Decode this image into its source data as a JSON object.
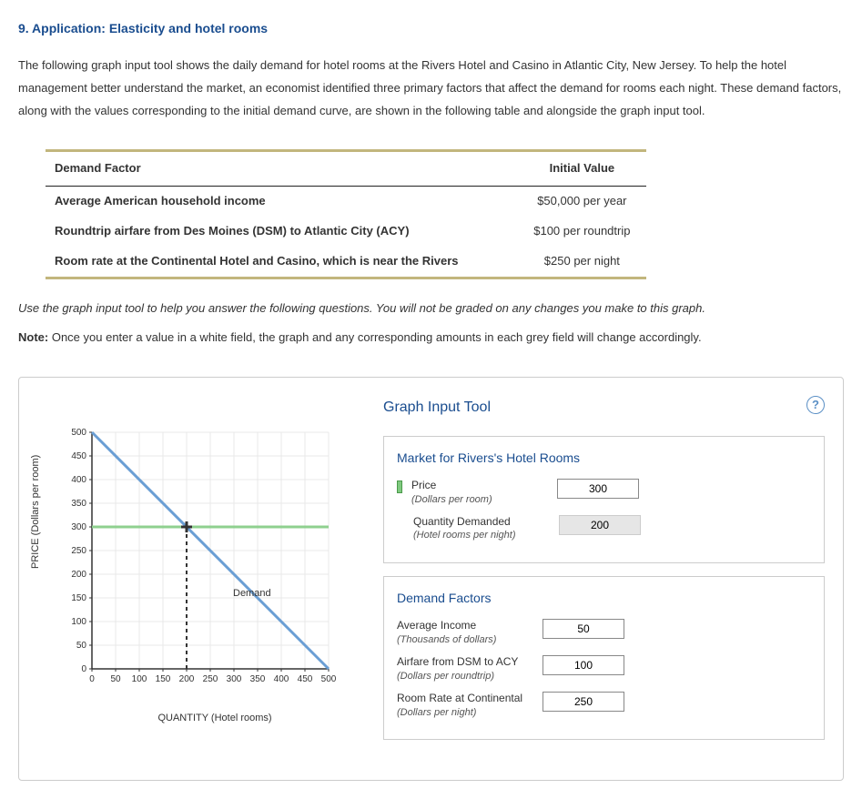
{
  "heading": "9. Application: Elasticity and hotel rooms",
  "intro": "The following graph input tool shows the daily demand for hotel rooms at the Rivers Hotel and Casino in Atlantic City, New Jersey. To help the hotel management better understand the market, an economist identified three primary factors that affect the demand for rooms each night. These demand factors, along with the values corresponding to the initial demand curve, are shown in the following table and alongside the graph input tool.",
  "table": {
    "headers": {
      "factor": "Demand Factor",
      "value": "Initial Value"
    },
    "rows": [
      {
        "factor": "Average American household income",
        "value": "$50,000 per year"
      },
      {
        "factor": "Roundtrip airfare from Des Moines (DSM) to Atlantic City (ACY)",
        "value": "$100 per roundtrip"
      },
      {
        "factor": "Room rate at the Continental Hotel and Casino, which is near the Rivers",
        "value": "$250 per night"
      }
    ]
  },
  "instruction": "Use the graph input tool to help you answer the following questions. You will not be graded on any changes you make to this graph.",
  "note_label": "Note:",
  "note": " Once you enter a value in a white field, the graph and any corresponding amounts in each grey field will change accordingly.",
  "tool": {
    "title": "Graph Input Tool",
    "market_title": "Market for Rivers's Hotel Rooms",
    "price": {
      "label": "Price",
      "sub": "(Dollars per room)",
      "value": "300"
    },
    "quantity": {
      "label": "Quantity Demanded",
      "sub": "(Hotel rooms per night)",
      "value": "200"
    },
    "factors_title": "Demand Factors",
    "income": {
      "label": "Average Income",
      "sub": "(Thousands of dollars)",
      "value": "50"
    },
    "airfare": {
      "label": "Airfare from DSM to ACY",
      "sub": "(Dollars per roundtrip)",
      "value": "100"
    },
    "rate": {
      "label": "Room Rate at Continental",
      "sub": "(Dollars per night)",
      "value": "250"
    }
  },
  "chart_data": {
    "type": "line",
    "title": "",
    "xlabel": "QUANTITY (Hotel rooms)",
    "ylabel": "PRICE (Dollars per room)",
    "xlim": [
      0,
      500
    ],
    "ylim": [
      0,
      500
    ],
    "xticks": [
      0,
      50,
      100,
      150,
      200,
      250,
      300,
      350,
      400,
      450,
      500
    ],
    "yticks": [
      0,
      50,
      100,
      150,
      200,
      250,
      300,
      350,
      400,
      450,
      500
    ],
    "series": [
      {
        "name": "Demand",
        "color": "#6a9ed4",
        "x": [
          0,
          500
        ],
        "y": [
          500,
          0
        ]
      },
      {
        "name": "PriceLine",
        "color": "#8fd08f",
        "x": [
          0,
          500
        ],
        "y": [
          300,
          300
        ]
      },
      {
        "name": "QuantityGuide",
        "color": "#333",
        "style": "dashed",
        "x": [
          200,
          200
        ],
        "y": [
          0,
          300
        ]
      }
    ],
    "point": {
      "x": 200,
      "y": 300
    },
    "annotations": [
      {
        "text": "Demand",
        "x": 290,
        "y": 160
      }
    ]
  },
  "chart_svg": {
    "yticks": [
      "500",
      "450",
      "400",
      "350",
      "300",
      "250",
      "200",
      "150",
      "100",
      "50",
      "0"
    ],
    "xticks": [
      "0",
      "50",
      "100",
      "150",
      "200",
      "250",
      "300",
      "350",
      "400",
      "450",
      "500"
    ],
    "demand_label": "Demand"
  }
}
